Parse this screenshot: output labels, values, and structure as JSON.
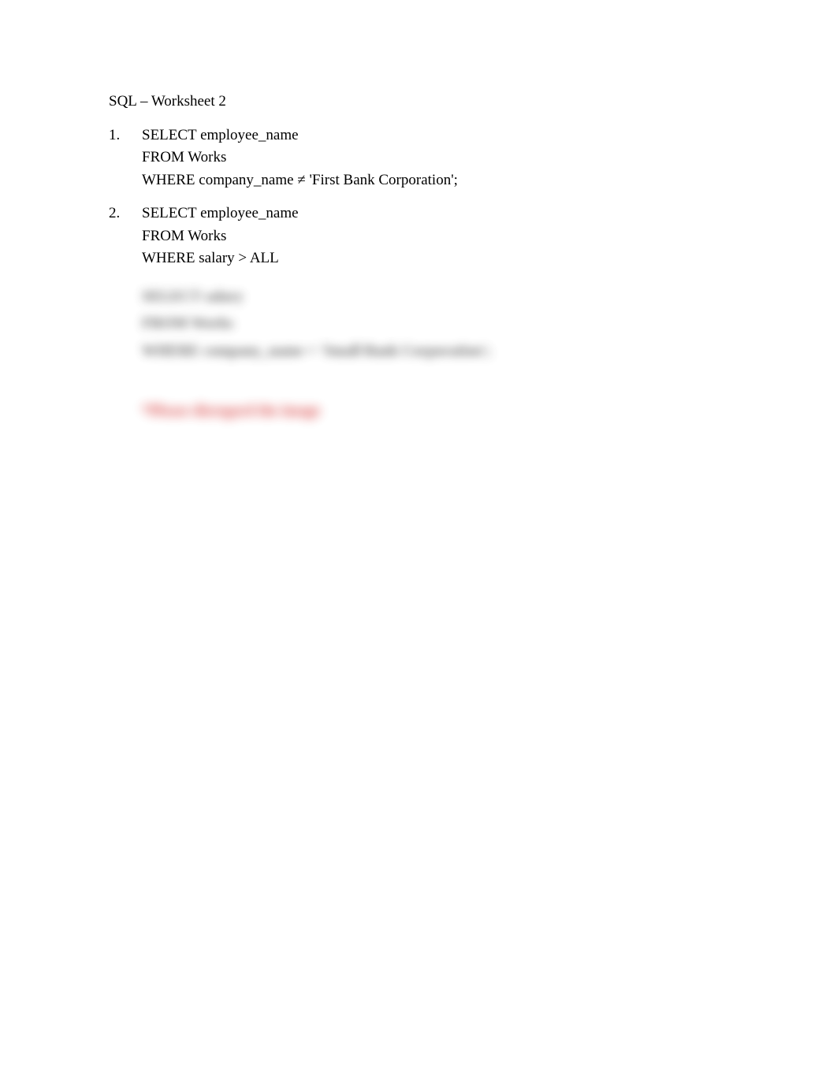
{
  "title": "SQL – Worksheet 2",
  "items": [
    {
      "number": "1.",
      "lines": [
        "SELECT employee_name",
        "FROM Works",
        "WHERE company_name ≠ 'First Bank Corporation';"
      ]
    },
    {
      "number": "2.",
      "lines": [
        "SELECT employee_name",
        "FROM Works",
        "WHERE salary > ALL"
      ]
    }
  ],
  "blurred1": {
    "lines": [
      "SELECT salary",
      "FROM Works",
      "WHERE company_name = 'Small Bank Corporation';"
    ]
  },
  "blurred2": {
    "line1": "",
    "line2_red": "*Please disregard the image",
    "line3": ""
  }
}
